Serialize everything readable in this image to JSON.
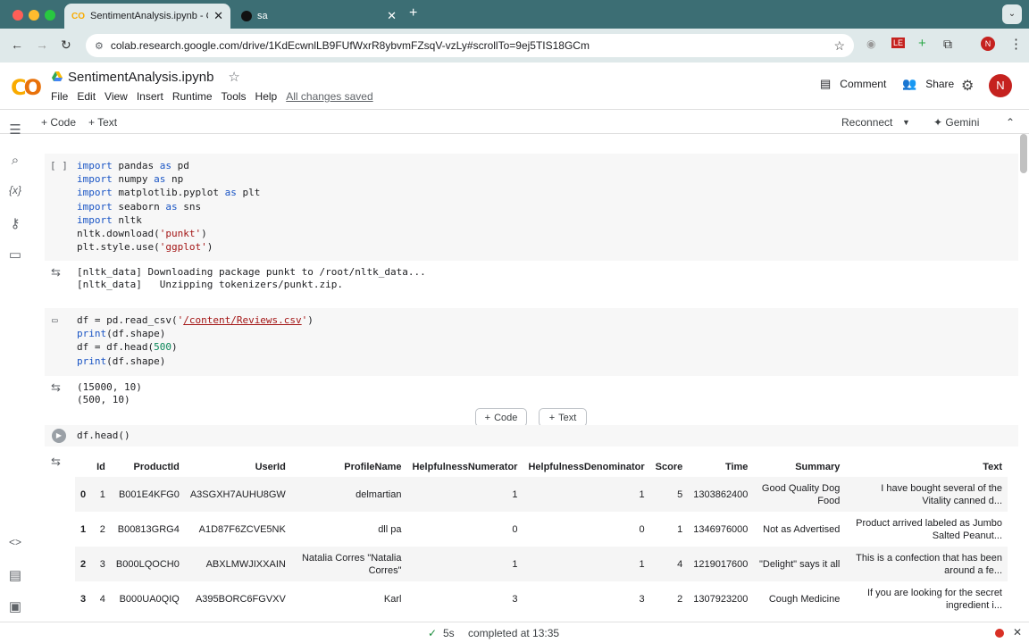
{
  "browser": {
    "tabs": [
      {
        "title": "SentimentAnalysis.ipynb - Colab"
      },
      {
        "title": "sa"
      }
    ],
    "url": "colab.research.google.com/drive/1KdEcwnlLB9FUfWxrR8ybvmFZsqV-vzLy#scrollTo=9ej5TIS18GCm"
  },
  "notebook": {
    "title": "SentimentAnalysis.ipynb",
    "menu": [
      "File",
      "Edit",
      "View",
      "Insert",
      "Runtime",
      "Tools",
      "Help"
    ],
    "saved_status": "All changes saved"
  },
  "header": {
    "comment_label": "Comment",
    "share_label": "Share",
    "avatar_letter": "N"
  },
  "toolbar": {
    "add_code": "Code",
    "add_text": "Text",
    "reconnect": "Reconnect",
    "gemini": "Gemini"
  },
  "cells": [
    {
      "bracket": "[ ]"
    },
    {
      "output": "[nltk_data] Downloading package punkt to /root/nltk_data...\n[nltk_data]   Unzipping tokenizers/punkt.zip."
    },
    {
      "output": "(15000, 10)\n(500, 10)"
    }
  ],
  "add_cell": {
    "code": "Code",
    "text": "Text"
  },
  "dataframe": {
    "columns": [
      "",
      "Id",
      "ProductId",
      "UserId",
      "ProfileName",
      "HelpfulnessNumerator",
      "HelpfulnessDenominator",
      "Score",
      "Time",
      "Summary",
      "Text"
    ],
    "rows": [
      [
        "0",
        "1",
        "B001E4KFG0",
        "A3SGXH7AUHU8GW",
        "delmartian",
        "1",
        "1",
        "5",
        "1303862400",
        "Good Quality Dog Food",
        "I have bought several of the Vitality canned d..."
      ],
      [
        "1",
        "2",
        "B00813GRG4",
        "A1D87F6ZCVE5NK",
        "dll pa",
        "0",
        "0",
        "1",
        "1346976000",
        "Not as Advertised",
        "Product arrived labeled as Jumbo Salted Peanut..."
      ],
      [
        "2",
        "3",
        "B000LQOCH0",
        "ABXLMWJIXXAIN",
        "Natalia Corres \"Natalia Corres\"",
        "1",
        "1",
        "4",
        "1219017600",
        "\"Delight\" says it all",
        "This is a confection that has been around a fe..."
      ],
      [
        "3",
        "4",
        "B000UA0QIQ",
        "A395BORC6FGVXV",
        "Karl",
        "3",
        "3",
        "2",
        "1307923200",
        "Cough Medicine",
        "If you are looking for the secret ingredient i..."
      ]
    ]
  },
  "status": {
    "duration": "5s",
    "completed": "completed at 13:35"
  },
  "colors": {
    "accent": "#3c6e74",
    "colab_orange": "#f9ab00",
    "avatar": "#c5221f"
  }
}
